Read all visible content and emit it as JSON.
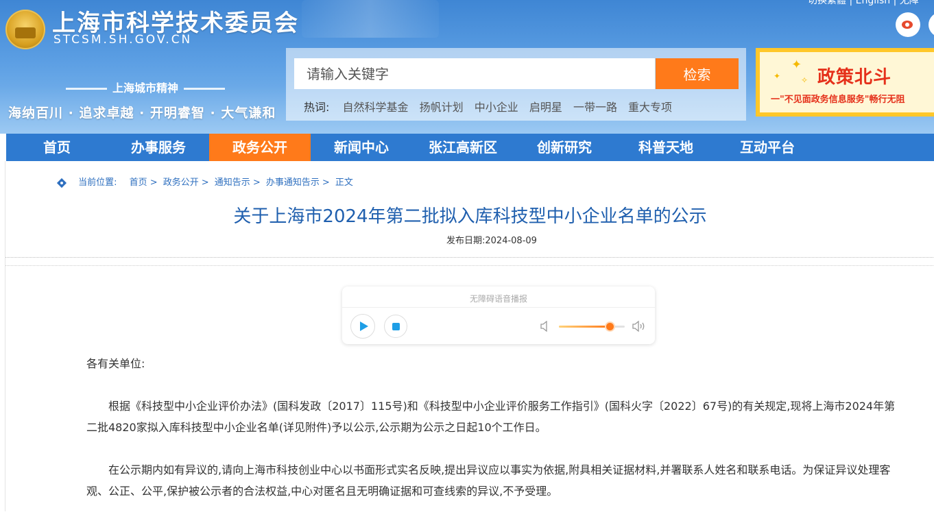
{
  "header": {
    "site_title": "上海市科学技术委员会",
    "site_domain": "STCSM.SH.GOV.CN",
    "spirit_heading": "上海城市精神",
    "spirit_text": "海纳百川 · 追求卓越 · 开明睿智 · 大气谦和",
    "top_links": "切换繁體 | English | 无障",
    "icons": [
      "weibo-icon",
      "wechat-icon"
    ]
  },
  "search": {
    "placeholder": "请输入关键字",
    "button_label": "检索",
    "hot_label": "热词:",
    "hot_words": [
      "自然科学基金",
      "扬帆计划",
      "中小企业",
      "启明星",
      "一带一路",
      "重大专项"
    ]
  },
  "banner": {
    "title": "政策北斗",
    "subtitle": "一\"不见面政务信息服务\"畅行无阻"
  },
  "nav": {
    "items": [
      "首页",
      "办事服务",
      "政务公开",
      "新闻中心",
      "张江高新区",
      "创新研究",
      "科普天地",
      "互动平台"
    ],
    "active_index": 2,
    "active_color": "#ff7a1a",
    "bar_color": "#2e7ad0"
  },
  "breadcrumb": {
    "label": "当前位置:",
    "items": [
      "首页",
      "政务公开",
      "通知告示",
      "办事通知告示",
      "正文"
    ]
  },
  "article": {
    "title": "关于上海市2024年第二批拟入库科技型中小企业名单的公示",
    "publish_date": "发布日期:2024-08-09",
    "salutation": "各有关单位:",
    "paragraphs": [
      "根据《科技型中小企业评价办法》(国科发政〔2017〕115号)和《科技型中小企业评价服务工作指引》(国科火字〔2022〕67号)的有关规定,现将上海市2024年第二批4820家拟入库科技型中小企业名单(详见附件)予以公示,公示期为公示之日起10个工作日。",
      "在公示期内如有异议的,请向上海市科技创业中心以书面形式实名反映,提出异议应以事实为依据,附具相关证据材料,并署联系人姓名和联系电话。为保证异议处理客观、公正、公平,保护被公示者的合法权益,中心对匿名且无明确证据和可查线索的异议,不予受理。"
    ]
  },
  "audio_player": {
    "title": "无障碍语音播报",
    "volume_fraction": 0.77,
    "accent_color": "#1e9ee6"
  }
}
